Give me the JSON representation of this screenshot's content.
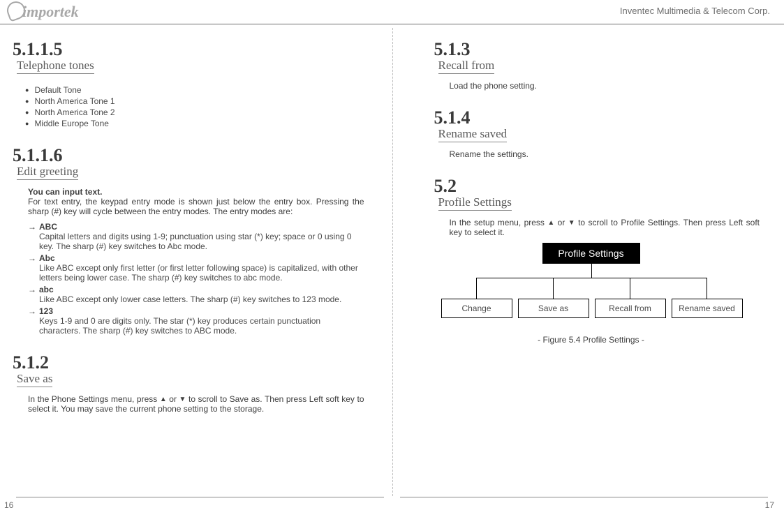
{
  "brand": {
    "logo_text": "importek",
    "corp": "Inventec Multimedia & Telecom Corp."
  },
  "left": {
    "s1": {
      "num": "5.1.1.5",
      "title": "Telephone tones",
      "bullets": [
        "Default Tone",
        "North America Tone 1",
        "North America Tone 2",
        "Middle Europe Tone"
      ]
    },
    "s2": {
      "num": "5.1.1.6",
      "title": "Edit greeting",
      "lead_bold": "You can input text.",
      "lead": "For text entry, the keypad entry mode is shown just below the entry box. Pressing the sharp (#) key will cycle between the entry modes. The entry modes are:",
      "modes": [
        {
          "head": "ABC",
          "desc": "Capital letters and digits using 1-9; punctuation using star (*) key; space or 0 using 0 key. The sharp (#) key switches to Abc mode."
        },
        {
          "head": "Abc",
          "desc": "Like ABC except only first letter (or first letter following space) is capitalized, with other letters being lower case. The sharp (#) key switches to abc mode."
        },
        {
          "head": "abc",
          "desc": "Like ABC except only lower case letters. The sharp (#) key switches to 123 mode."
        },
        {
          "head": "123",
          "desc": "Keys 1-9 and 0 are digits only. The star (*) key produces certain punctuation characters. The sharp (#) key switches to ABC mode."
        }
      ]
    },
    "s3": {
      "num": "5.1.2",
      "title": "Save as",
      "para_pre": "In the Phone Settings menu, press ",
      "para_mid": " or ",
      "para_post": " to scroll to Save as. Then press Left soft key to select it. You may save the current phone setting to the storage."
    },
    "pagenum": "16"
  },
  "right": {
    "s1": {
      "num": "5.1.3",
      "title": "Recall from",
      "para": "Load the phone setting."
    },
    "s2": {
      "num": "5.1.4",
      "title": "Rename saved",
      "para": "Rename the settings."
    },
    "s3": {
      "num": "5.2",
      "title": "Profile Settings",
      "para_pre": "In the setup menu, press ",
      "para_mid": " or ",
      "para_post": " to scroll to Profile Settings. Then press Left soft key to select it."
    },
    "diagram": {
      "root": "Profile Settings",
      "leaves": [
        "Change",
        "Save as",
        "Recall from",
        "Rename saved"
      ],
      "caption": "- Figure 5.4 Profile Settings -"
    },
    "pagenum": "17"
  }
}
